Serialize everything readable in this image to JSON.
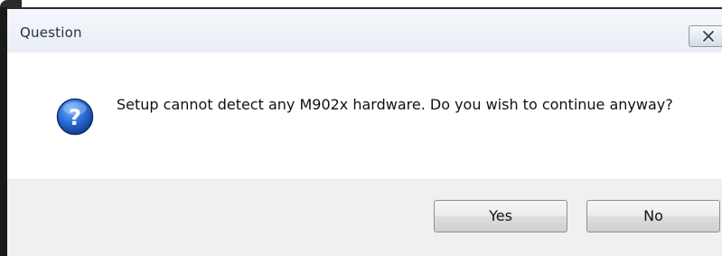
{
  "dialog": {
    "title": "Question",
    "message": "Setup cannot detect any M902x hardware.  Do you wish to continue anyway?",
    "icon": "question-icon",
    "buttons": {
      "yes_label": "Yes",
      "no_label": "No"
    },
    "colors": {
      "icon_blue": "#1f5fbf",
      "footer_bg": "#f2efef",
      "title_bg": "#eef2f7"
    }
  }
}
